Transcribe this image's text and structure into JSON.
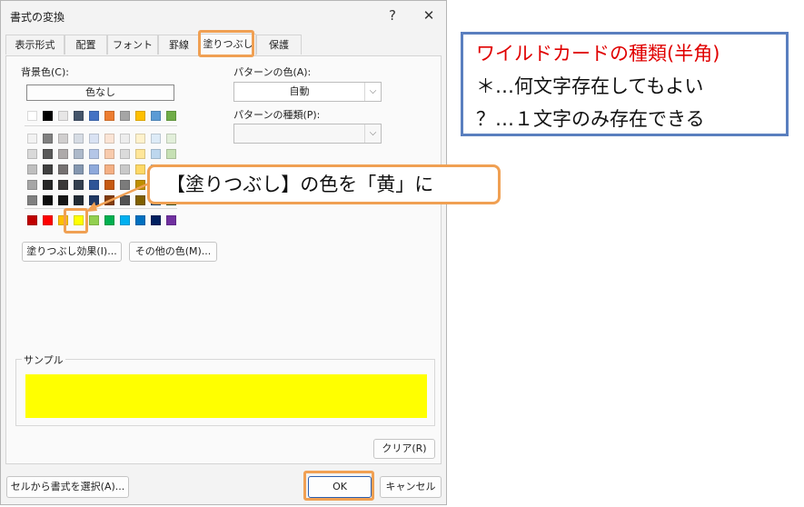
{
  "dialog": {
    "title": "書式の変換",
    "help_label": "?",
    "close_label": "✕"
  },
  "tabs": [
    {
      "label": "表示形式"
    },
    {
      "label": "配置"
    },
    {
      "label": "フォント"
    },
    {
      "label": "罫線"
    },
    {
      "label": "塗りつぶし"
    },
    {
      "label": "保護"
    }
  ],
  "fill": {
    "bg_color_label": "背景色(C):",
    "no_color_label": "色なし",
    "effects_button": "塗りつぶし効果(I)...",
    "more_colors_button": "その他の色(M)...",
    "pattern_color_label": "パターンの色(A):",
    "pattern_color_value": "自動",
    "pattern_type_label": "パターンの種類(P):",
    "pattern_type_value": "",
    "sample_label": "サンプル",
    "sample_color": "#ffff00",
    "clear_button": "クリア(R)"
  },
  "palette": {
    "theme_top": [
      "#ffffff",
      "#000000",
      "#e7e6e6",
      "#44546a",
      "#4472c4",
      "#ed7d31",
      "#a5a5a5",
      "#ffc000",
      "#5b9bd5",
      "#70ad47"
    ],
    "theme_shades": [
      [
        "#f2f2f2",
        "#808080",
        "#d0cece",
        "#d6dce4",
        "#d9e2f3",
        "#fbe4d5",
        "#ededed",
        "#fff2cc",
        "#ddebf7",
        "#e2efda"
      ],
      [
        "#d9d9d9",
        "#595959",
        "#aeaaaa",
        "#adb9ca",
        "#b4c6e7",
        "#f8cbad",
        "#dbdbdb",
        "#ffe699",
        "#bdd7ee",
        "#c6e0b4"
      ],
      [
        "#bfbfbf",
        "#404040",
        "#757171",
        "#8497b0",
        "#8ea9db",
        "#f4b084",
        "#c9c9c9",
        "#ffd966",
        "#9bc2e6",
        "#a9d08e"
      ],
      [
        "#a6a6a6",
        "#262626",
        "#3a3838",
        "#333f4f",
        "#2f5597",
        "#c65911",
        "#7b7b7b",
        "#bf8f00",
        "#2e75b6",
        "#548235"
      ],
      [
        "#808080",
        "#0d0d0d",
        "#161616",
        "#222b35",
        "#1f3864",
        "#833c0c",
        "#525252",
        "#806000",
        "#1f4e78",
        "#375623"
      ]
    ],
    "standard": [
      "#c00000",
      "#ff0000",
      "#ffc000",
      "#ffff00",
      "#92d050",
      "#00b050",
      "#00b0f0",
      "#0070c0",
      "#002060",
      "#7030a0"
    ]
  },
  "footer": {
    "select_from_cell_button": "セルから書式を選択(A)...",
    "ok_button": "OK",
    "cancel_button": "キャンセル"
  },
  "annotation": {
    "callout_text": "【塗りつぶし】の色を「黄」に",
    "accent_color": "#f0a053"
  },
  "info_box": {
    "title": "ワイルドカードの種類(半角)",
    "title_color": "#e00000",
    "line1": "＊…何文字存在してもよい",
    "line2": "？…１文字のみ存在できる",
    "border_color": "#5a7fbf"
  }
}
